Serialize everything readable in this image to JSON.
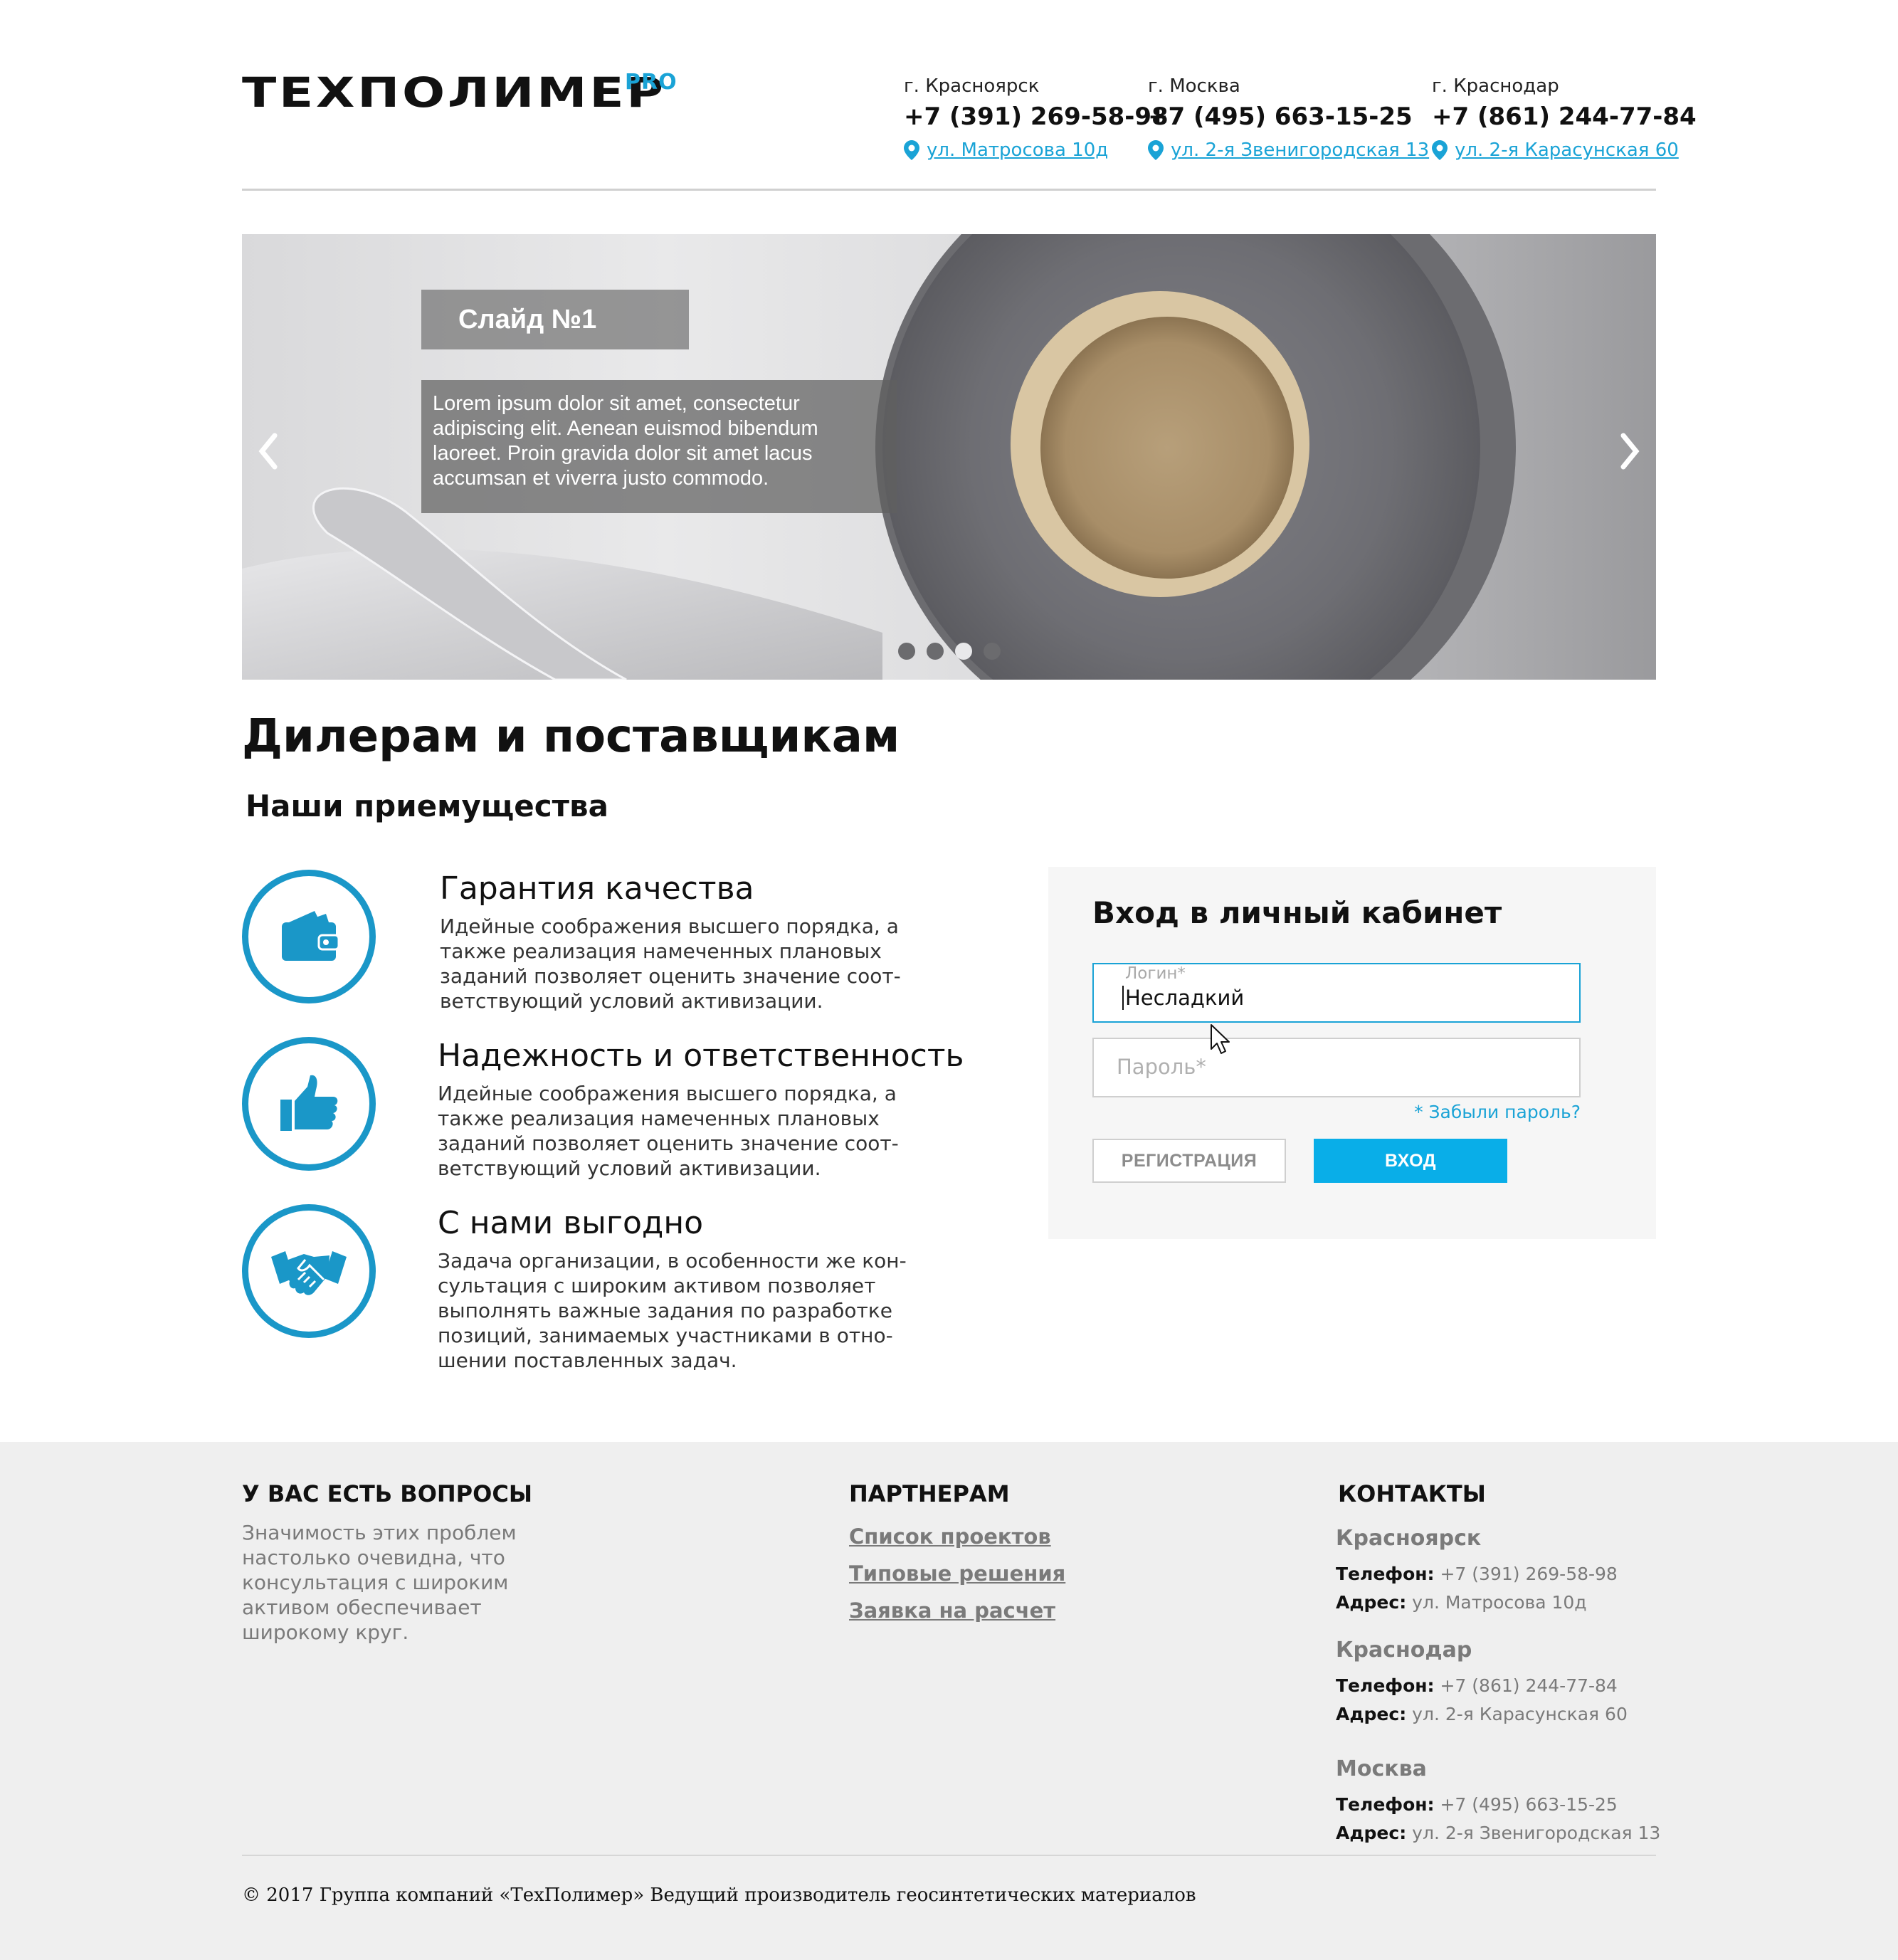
{
  "header": {
    "logo_main": "ТЕХПОЛИМЕР",
    "logo_pro": "PRO",
    "offices": [
      {
        "city": "г. Красноярск",
        "phone": "+7 (391) 269-58-98",
        "address": "ул. Матросова 10д"
      },
      {
        "city": "г. Москва",
        "phone": "+7 (495) 663-15-25",
        "address": "ул. 2-я Звенигородская 13"
      },
      {
        "city": "г. Краснодар",
        "phone": "+7 (861) 244-77-84",
        "address": "ул. 2-я Карасунская 60"
      }
    ]
  },
  "slider": {
    "title": "Слайд №1",
    "text": "Lorem ipsum dolor sit amet, consectetur adipiscing elit. Aenean euismod bibendum laoreet. Proin gravida dolor sit amet lacus accumsan et viverra justo commodo.",
    "dots": 4,
    "active_dot": 3
  },
  "main": {
    "title": "Дилерам и поставщикам",
    "subtitle": "Наши приемущества",
    "features": [
      {
        "icon": "wallet-icon",
        "title": "Гарантия качества",
        "text": "Идейные соображения высшего порядка, а также реализация намеченных плановых заданий позволяет оценить значение соот-ветствующий условий активизации."
      },
      {
        "icon": "thumbs-up-icon",
        "title": "Надежность и ответственность",
        "text": "Идейные соображения высшего порядка, а также реализация намеченных плановых заданий позволяет оценить значение соот-ветствующий условий активизации."
      },
      {
        "icon": "handshake-icon",
        "title": "С нами выгодно",
        "text": "Задача организации, в особенности же кон-сультация с широким активом позволяет выполнять важные задания по разработке позиций, занимаемых участниками в отно-шении поставленных задач."
      }
    ]
  },
  "login": {
    "title": "Вход в личный кабинет",
    "login_label": "Логин*",
    "login_value": "Несладкий",
    "password_placeholder": "Пароль*",
    "forgot": "* Забыли пароль?",
    "register_button": "РЕГИСТРАЦИЯ",
    "login_button": "ВХОД"
  },
  "footer": {
    "questions": {
      "title": "У ВАС ЕСТЬ ВОПРОСЫ",
      "text": "Значимость этих проблем настолько очевидна, что консультация с широким активом обеспечивает широкому круг."
    },
    "partners": {
      "title": "ПАРТНЕРАМ",
      "links": [
        "Список проектов",
        "Типовые решения",
        "Заявка на расчет"
      ]
    },
    "contacts": {
      "title": "КОНТАКТЫ",
      "phone_label": "Телефон:",
      "address_label": "Адрес:",
      "cities": [
        {
          "name": "Красноярск",
          "phone": "+7 (391) 269-58-98",
          "address": "ул. Матросова 10д"
        },
        {
          "name": "Краснодар",
          "phone": "+7 (861) 244-77-84",
          "address": "ул. 2-я Карасунская 60"
        },
        {
          "name": "Москва",
          "phone": "+7 (495) 663-15-25",
          "address": "ул. 2-я Звенигородская 13"
        }
      ]
    },
    "copyright": "© 2017 Группа компаний «ТехПолимер» Ведущий производитель геосинтетических материалов"
  },
  "colors": {
    "accent": "#1aa3d6",
    "button": "#09aee8",
    "icon_ring": "#1a97c8",
    "footer_bg": "#efefef"
  }
}
